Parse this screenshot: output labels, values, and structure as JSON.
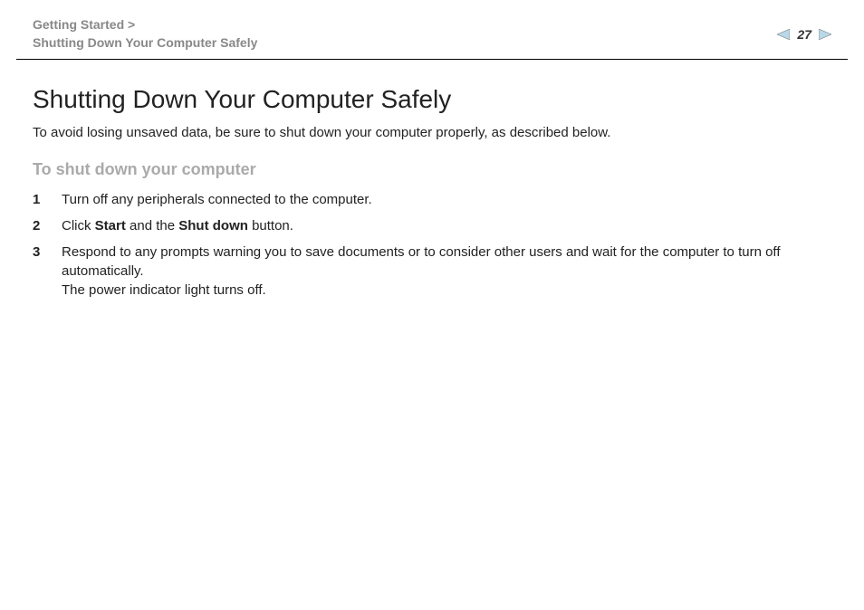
{
  "header": {
    "breadcrumb_section": "Getting Started >",
    "breadcrumb_page": "Shutting Down Your Computer Safely",
    "page_number": "27"
  },
  "content": {
    "title": "Shutting Down Your Computer Safely",
    "intro": "To avoid losing unsaved data, be sure to shut down your computer properly, as described below.",
    "subtitle": "To shut down your computer",
    "steps": [
      {
        "num": "1",
        "text": "Turn off any peripherals connected to the computer."
      },
      {
        "num": "2",
        "prefix": "Click ",
        "bold1": "Start",
        "mid": " and the ",
        "bold2": "Shut down",
        "suffix": " button."
      },
      {
        "num": "3",
        "line1": "Respond to any prompts warning you to save documents or to consider other users and wait for the computer to turn off automatically.",
        "line2": "The power indicator light turns off."
      }
    ]
  }
}
